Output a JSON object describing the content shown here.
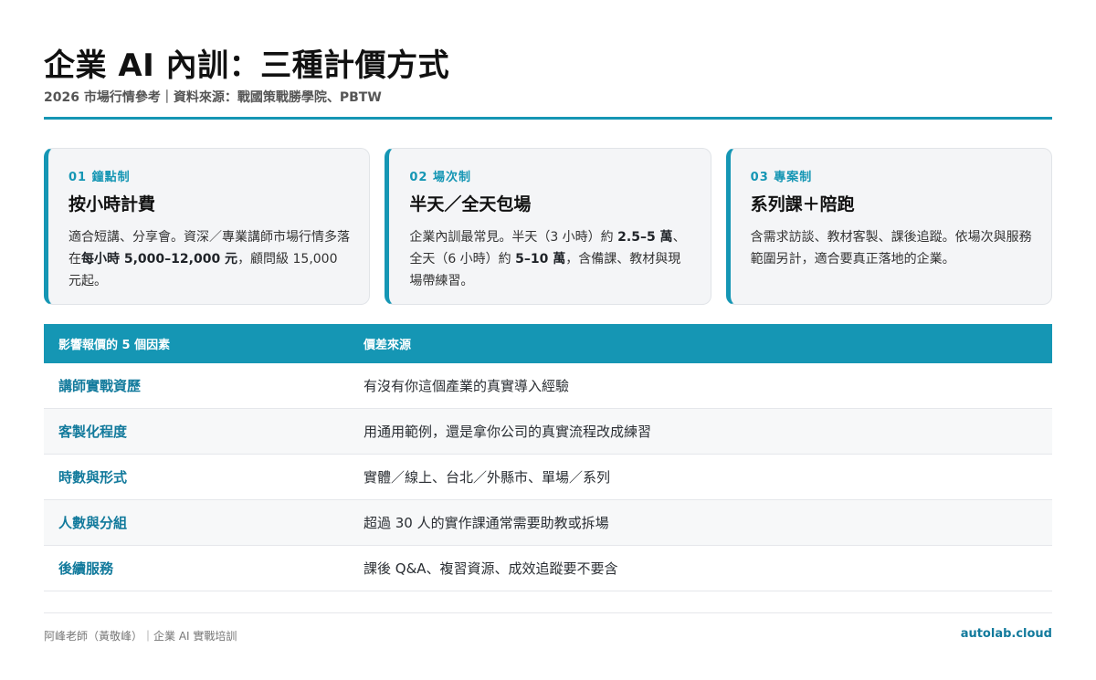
{
  "header": {
    "title": "企業 AI 內訓：三種計價方式",
    "subtitle": "2026 市場行情參考｜資料來源：戰國策戰勝學院、PBTW"
  },
  "cards": [
    {
      "kicker": "01 鐘點制",
      "title": "按小時計費",
      "body": [
        {
          "t": "適合短講、分享會。資深／專業講師市場行情多落在",
          "b": false
        },
        {
          "t": "每小時 5,000–12,000 元",
          "b": true
        },
        {
          "t": "，顧問級 15,000 元起。",
          "b": false
        }
      ]
    },
    {
      "kicker": "02 場次制",
      "title": "半天／全天包場",
      "body": [
        {
          "t": "企業內訓最常見。半天（3 小時）約 ",
          "b": false
        },
        {
          "t": "2.5–5 萬",
          "b": true
        },
        {
          "t": "、全天（6 小時）約 ",
          "b": false
        },
        {
          "t": "5–10 萬",
          "b": true
        },
        {
          "t": "，含備課、教材與現場帶練習。",
          "b": false
        }
      ]
    },
    {
      "kicker": "03 專案制",
      "title": "系列課＋陪跑",
      "body": [
        {
          "t": "含需求訪談、教材客製、課後追蹤。依場次與服務範圍另計，適合要真正落地的企業。",
          "b": false
        }
      ]
    }
  ],
  "table": {
    "headers": [
      "影響報價的 5 個因素",
      "價差來源"
    ],
    "rows": [
      [
        "講師實戰資歷",
        "有沒有你這個產業的真實導入經驗"
      ],
      [
        "客製化程度",
        "用通用範例，還是拿你公司的真實流程改成練習"
      ],
      [
        "時數與形式",
        "實體／線上、台北／外縣市、單場／系列"
      ],
      [
        "人數與分組",
        "超過 30 人的實作課通常需要助教或拆場"
      ],
      [
        "後續服務",
        "課後 Q&A、複習資源、成效追蹤要不要含"
      ]
    ]
  },
  "footer": {
    "left": "阿峰老師（黃敬峰）｜企業 AI 實戰培訓",
    "right": "autolab.cloud"
  },
  "colors": {
    "accent": "#1596b4",
    "accent_dark": "#127a9c"
  }
}
